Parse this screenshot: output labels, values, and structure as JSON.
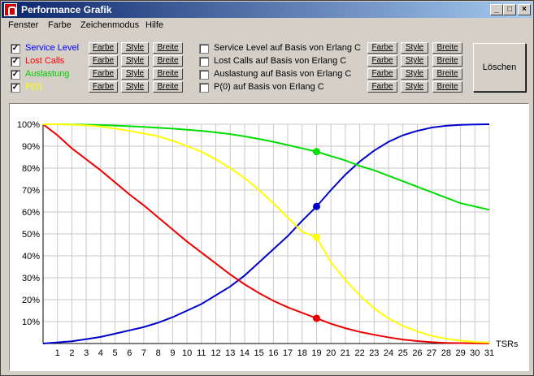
{
  "window": {
    "title": "Performance Grafik"
  },
  "titlebar_buttons": {
    "minimize": "_",
    "maximize": "□",
    "close": "×"
  },
  "menu": [
    "Fenster",
    "Farbe",
    "Zeichenmodus",
    "Hilfe"
  ],
  "series_controls": [
    {
      "label": "Service Level",
      "color": "#0000ff",
      "checked": true
    },
    {
      "label": "Lost Calls",
      "color": "#ff0000",
      "checked": true
    },
    {
      "label": "Auslastung",
      "color": "#00cc00",
      "checked": true
    },
    {
      "label": "P(0)",
      "color": "#ffff00",
      "checked": true
    }
  ],
  "series_buttons": {
    "farbe": "Farbe",
    "style": "Style",
    "breite": "Breite"
  },
  "erlang_controls": [
    {
      "label": "Service Level auf Basis von Erlang C",
      "checked": false
    },
    {
      "label": "Lost Calls auf Basis von Erlang C",
      "checked": false
    },
    {
      "label": "Auslastung auf Basis von Erlang C",
      "checked": false
    },
    {
      "label": "P(0) auf Basis von Erlang C",
      "checked": false
    }
  ],
  "clear_button": "Löschen",
  "chart_data": {
    "type": "line",
    "xlabel": "TSRs",
    "x": [
      0,
      1,
      2,
      3,
      4,
      5,
      6,
      7,
      8,
      9,
      10,
      11,
      12,
      13,
      14,
      15,
      16,
      17,
      18,
      19,
      20,
      21,
      22,
      23,
      24,
      25,
      26,
      27,
      28,
      29,
      30,
      31
    ],
    "y_ticks": [
      "10%",
      "20%",
      "30%",
      "40%",
      "50%",
      "60%",
      "70%",
      "80%",
      "90%",
      "100%"
    ],
    "ylim": [
      0,
      100
    ],
    "xlim": [
      0,
      31
    ],
    "grid": true,
    "marker_x": 19,
    "series": [
      {
        "name": "Service Level",
        "color": "#0000cc",
        "values": [
          0,
          0.5,
          1,
          2,
          3,
          4.5,
          6,
          7.5,
          9.5,
          12,
          15,
          18,
          22,
          26,
          31,
          37,
          43,
          49,
          56,
          62.5,
          70,
          77,
          83,
          88,
          92,
          95,
          97,
          98.5,
          99.3,
          99.7,
          99.9,
          100
        ]
      },
      {
        "name": "Lost Calls",
        "color": "#ee0000",
        "values": [
          100,
          95,
          89,
          84,
          79,
          73.5,
          68,
          63,
          57.5,
          52,
          46.5,
          41.5,
          36.5,
          31.5,
          27,
          23,
          19.5,
          16.5,
          14,
          11.5,
          9,
          7,
          5.3,
          4,
          2.8,
          1.8,
          1.1,
          0.6,
          0.3,
          0.2,
          0.1,
          0
        ]
      },
      {
        "name": "Auslastung",
        "color": "#00dd00",
        "values": [
          100,
          100,
          99.9,
          99.8,
          99.6,
          99.4,
          99.1,
          98.8,
          98.4,
          98,
          97.5,
          97,
          96.3,
          95.5,
          94.5,
          93.3,
          92,
          90.5,
          89,
          87.5,
          85.5,
          83.5,
          81,
          79,
          76.5,
          74,
          71.5,
          69,
          66.5,
          64,
          62.5,
          61
        ]
      },
      {
        "name": "P(0)",
        "color": "#ffff00",
        "values": [
          100,
          100,
          99.8,
          99.5,
          99,
          98,
          97,
          95.8,
          94.5,
          92.5,
          90,
          87.5,
          84,
          80,
          75.5,
          70,
          64,
          57.5,
          51,
          48.5,
          37,
          29,
          22,
          16,
          11.5,
          8,
          5.5,
          3.5,
          2.2,
          1.3,
          0.7,
          0.4
        ]
      }
    ]
  }
}
